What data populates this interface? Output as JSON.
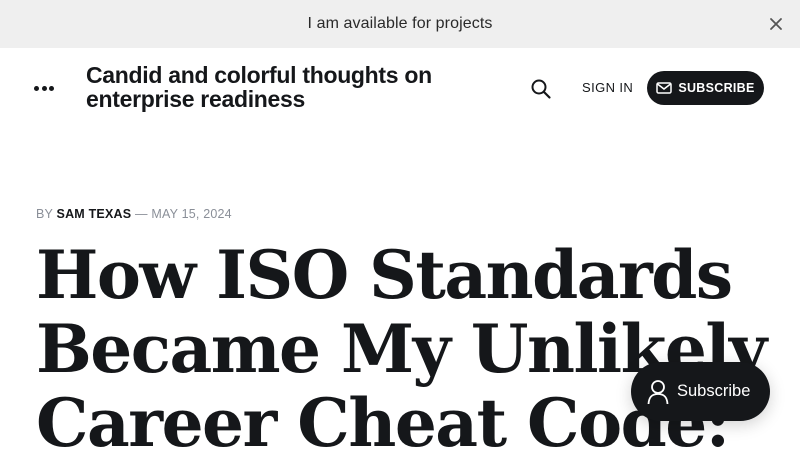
{
  "announcement": {
    "text": "I am available for projects",
    "close_icon": "close-icon"
  },
  "header": {
    "menu_icon": "more-dots-icon",
    "site_title": "Candid and colorful thoughts on enterprise readiness",
    "search_icon": "search-icon",
    "signin_label": "SIGN IN",
    "subscribe_label": "SUBSCRIBE",
    "subscribe_icon": "envelope-icon"
  },
  "article": {
    "by_prefix": "BY",
    "author": "SAM TEXAS",
    "date_sep": "—",
    "date": "MAY 15, 2024",
    "title": "How ISO Standards Became My Unlikely Career Cheat Code:"
  },
  "portal": {
    "label": "Subscribe",
    "icon": "user-icon"
  },
  "colors": {
    "announcement_bg": "#efefef",
    "brand_dark": "#15171a",
    "muted": "#8a8f98"
  }
}
